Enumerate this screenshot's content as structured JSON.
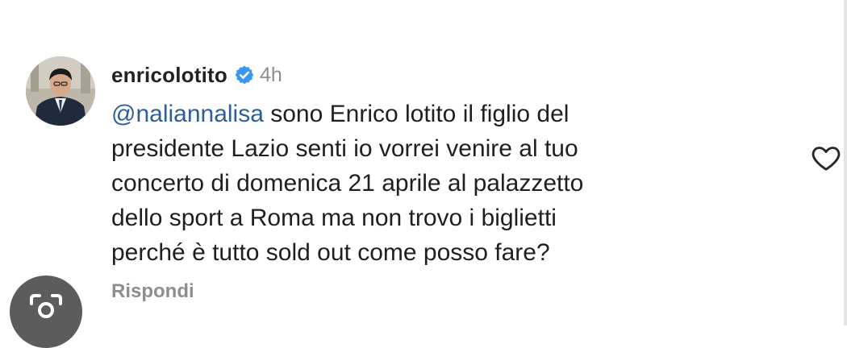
{
  "comment": {
    "username": "enricolotito",
    "timestamp": "4h",
    "mention": "@naliannalisa",
    "text": " sono Enrico lotito il figlio del\npresidente Lazio senti io vorrei venire al tuo\nconcerto di domenica 21 aprile al palazzetto\ndello sport a Roma ma non trovo i biglietti\nperché è tutto sold out come posso fare?",
    "reply_label": "Rispondi",
    "like_icon": "heart-outline-icon",
    "verified_icon": "verified-badge-icon"
  },
  "overlay": {
    "lens_icon": "lens-search-icon"
  },
  "colors": {
    "mention": "#2f5e96",
    "verified": "#3897f0",
    "muted_text": "#8e8e8e",
    "lens_bg": "#5c5c5c"
  }
}
